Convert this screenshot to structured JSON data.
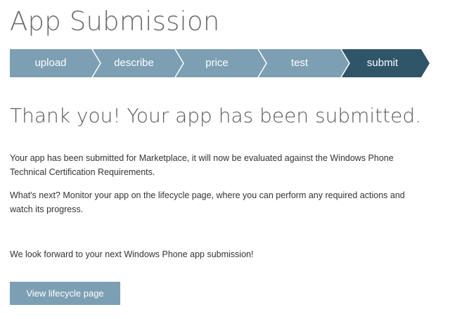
{
  "page": {
    "title": "App Submission"
  },
  "stepper": {
    "steps": [
      {
        "label": "upload",
        "state": "completed"
      },
      {
        "label": "describe",
        "state": "completed"
      },
      {
        "label": "price",
        "state": "completed"
      },
      {
        "label": "test",
        "state": "completed"
      },
      {
        "label": "submit",
        "state": "current"
      }
    ],
    "colors": {
      "completed": "#7c9fb3",
      "current": "#2f5569",
      "separator": "#ffffff"
    }
  },
  "confirmation": {
    "heading": "Thank you! Your app has been submitted.",
    "paragraph_1": "Your app has been submitted for Marketplace, it will now be evaluated against the Windows Phone Technical Certification Requirements.",
    "paragraph_2": "What's next? Monitor your app on the lifecycle page, where you can perform any required actions and watch its progress.",
    "paragraph_3": "We look forward to your next Windows Phone app submission!"
  },
  "actions": {
    "view_lifecycle_label": "View lifecycle page"
  }
}
